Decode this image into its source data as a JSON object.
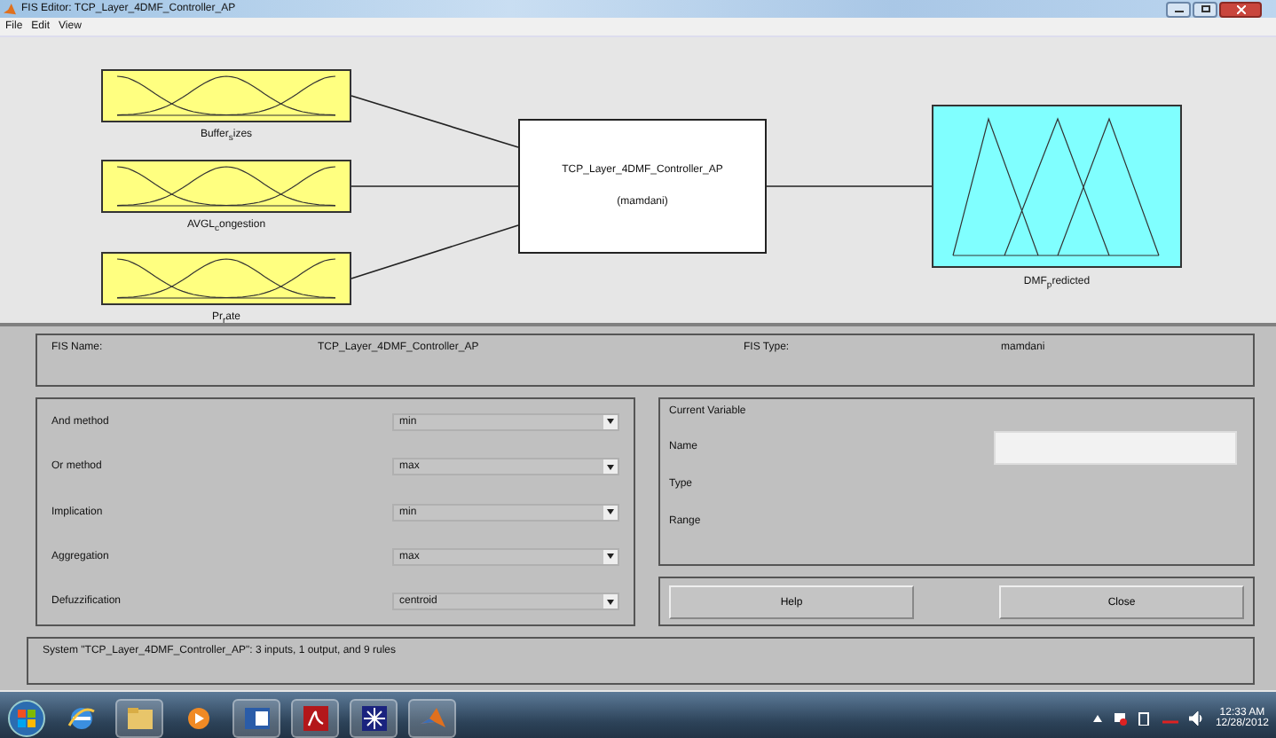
{
  "window": {
    "title": "FIS Editor: TCP_Layer_4DMF_Controller_AP"
  },
  "menu": [
    "File",
    "Edit",
    "View"
  ],
  "diagram": {
    "inputs": [
      {
        "label": "Buffer$_{s}$izes"
      },
      {
        "label": "AVGL$_{c}$ongestion"
      },
      {
        "label": "Pr$_{r}$ate"
      }
    ],
    "system": {
      "name": "TCP_Layer_4DMF_Controller_AP",
      "type": "(mamdani)"
    },
    "outputs": [
      {
        "label": "DMF$_{p}$redicted"
      }
    ]
  },
  "fis": {
    "name_label": "FIS Name:",
    "name": "TCP_Layer_4DMF_Controller_AP",
    "type_label": "FIS Type:",
    "type": "mamdani"
  },
  "methods": [
    {
      "label": "And method",
      "value": "min"
    },
    {
      "label": "Or method",
      "value": "max"
    },
    {
      "label": "Implication",
      "value": "min"
    },
    {
      "label": "Aggregation",
      "value": "max"
    },
    {
      "label": "Defuzzification",
      "value": "centroid"
    }
  ],
  "current_variable": {
    "title": "Current Variable",
    "fields": [
      {
        "label": "Name",
        "kind": "input"
      },
      {
        "label": "Type",
        "kind": "text"
      },
      {
        "label": "Range",
        "kind": "text"
      }
    ]
  },
  "buttons": [
    "Help",
    "Close"
  ],
  "status": "System \"TCP_Layer_4DMF_Controller_AP\": 3 inputs, 1 output, and 9 rules",
  "taskbar": {
    "apps": [
      {
        "kind": "ie"
      },
      {
        "kind": "folder"
      },
      {
        "kind": "media"
      },
      {
        "kind": "doc"
      },
      {
        "kind": "pdf"
      },
      {
        "kind": "star"
      },
      {
        "kind": "matlab"
      }
    ],
    "time": "12:33 AM",
    "date": "12/28/2012"
  }
}
